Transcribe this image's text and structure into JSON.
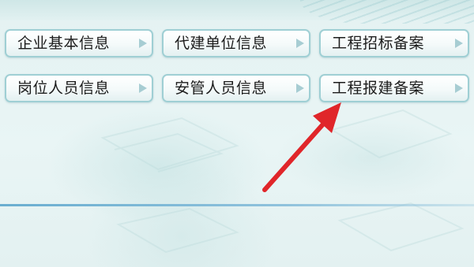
{
  "menu": {
    "rows": [
      [
        {
          "label": "企业基本信息",
          "icon": "triangle-right-icon"
        },
        {
          "label": "代建单位信息",
          "icon": "triangle-right-icon"
        },
        {
          "label": "工程招标备案",
          "icon": "triangle-right-icon"
        }
      ],
      [
        {
          "label": "岗位人员信息",
          "icon": "triangle-right-icon"
        },
        {
          "label": "安管人员信息",
          "icon": "triangle-right-icon"
        },
        {
          "label": "工程报建备案",
          "icon": "triangle-right-icon"
        }
      ]
    ]
  },
  "annotation": {
    "icon": "red-pointer-arrow-icon",
    "color": "#e0262a"
  },
  "theme": {
    "background": "#e6f3f3",
    "button_border": "#9fcfd4",
    "divider": "#6aaed0"
  }
}
